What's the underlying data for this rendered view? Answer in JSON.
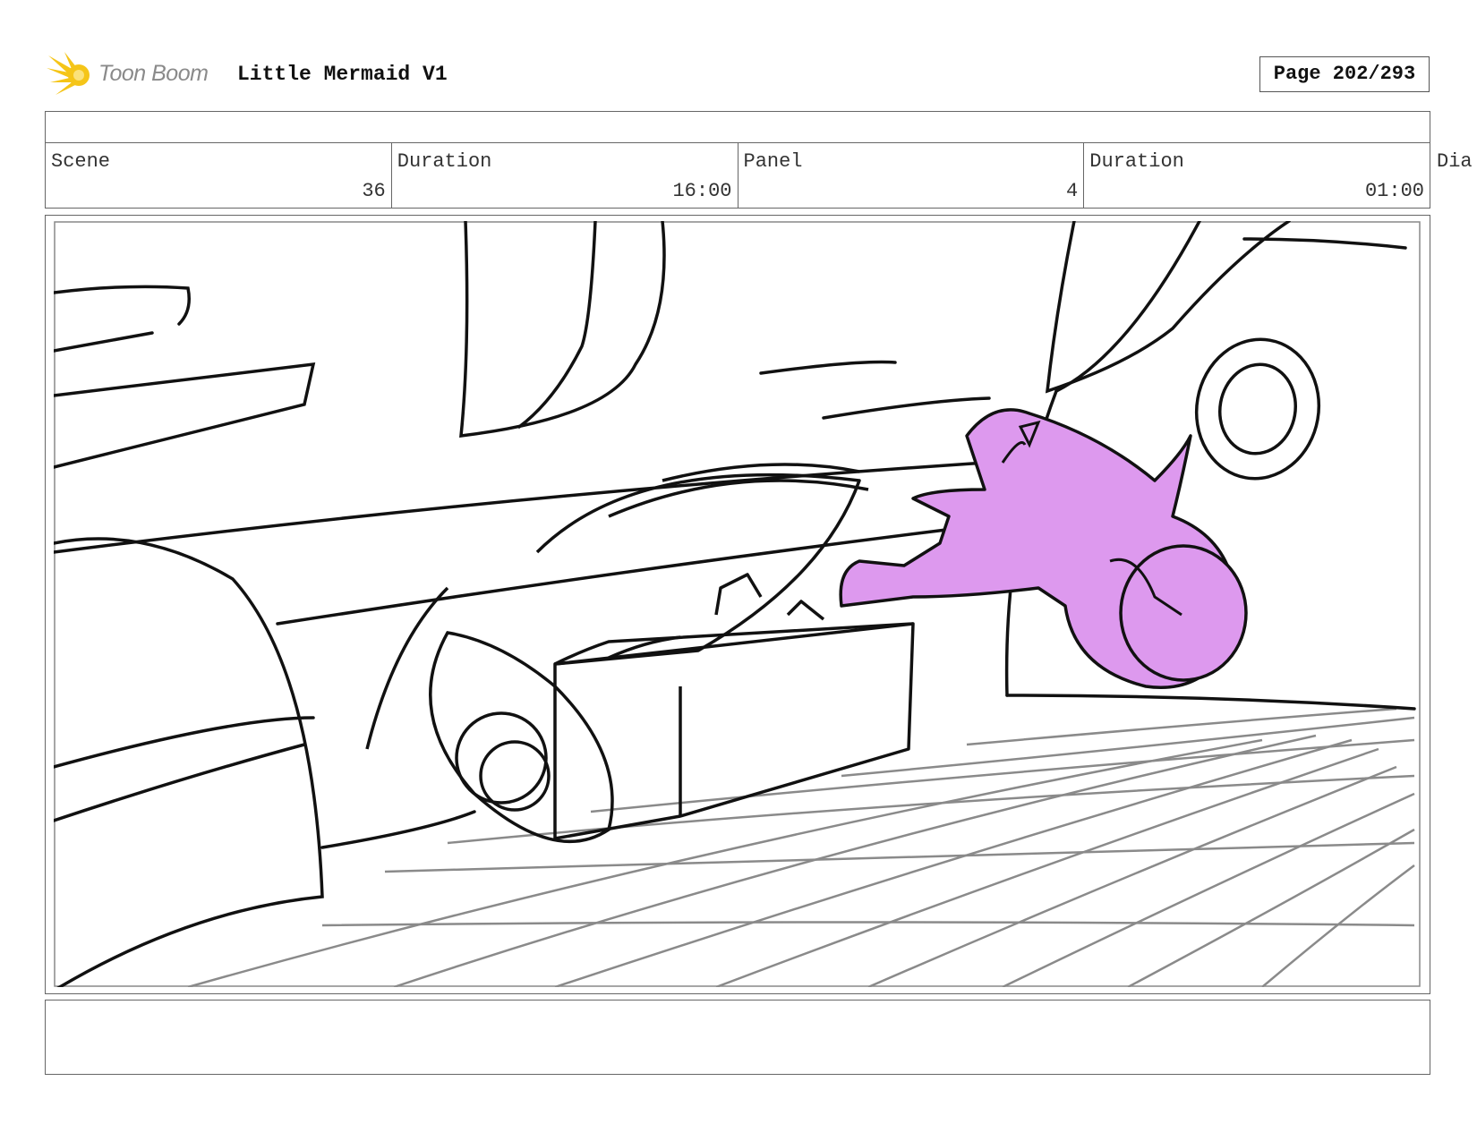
{
  "header": {
    "logo_text": "Toon Boom",
    "title": "Little Mermaid V1",
    "page_label": "Page 202/293"
  },
  "info": {
    "scene_label": "Scene",
    "scene_value": "36",
    "scene_duration_label": "Duration",
    "scene_duration_value": "16:00",
    "panel_label": "Panel",
    "panel_value": "4",
    "panel_duration_label": "Duration",
    "panel_duration_value": "01:00",
    "dialogue_label": "Dia"
  },
  "colors": {
    "logo_yellow": "#f5c518",
    "mermaid_fill": "#dd99ee",
    "border": "#666666"
  }
}
